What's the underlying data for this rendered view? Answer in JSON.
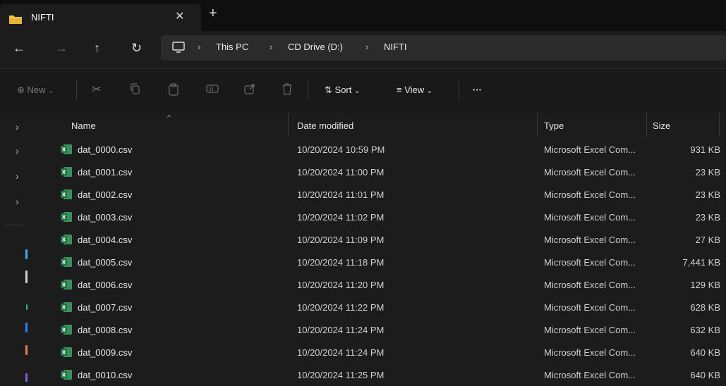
{
  "tab": {
    "title": "NIFTI",
    "close": "✕",
    "new": "+"
  },
  "nav": {
    "back": "←",
    "forward": "→",
    "up": "↑",
    "refresh": "↻"
  },
  "breadcrumb": [
    {
      "label": "This PC"
    },
    {
      "label": "CD Drive (D:)"
    },
    {
      "label": "NIFTI"
    }
  ],
  "toolbar": {
    "new_label": "New",
    "sort_label": "Sort",
    "view_label": "View",
    "more_label": "···"
  },
  "columns": {
    "name": "Name",
    "date": "Date modified",
    "type": "Type",
    "size": "Size"
  },
  "files": [
    {
      "name": "dat_0000.csv",
      "date": "10/20/2024 10:59 PM",
      "type": "Microsoft Excel Com...",
      "size": "931 KB"
    },
    {
      "name": "dat_0001.csv",
      "date": "10/20/2024 11:00 PM",
      "type": "Microsoft Excel Com...",
      "size": "23 KB"
    },
    {
      "name": "dat_0002.csv",
      "date": "10/20/2024 11:01 PM",
      "type": "Microsoft Excel Com...",
      "size": "23 KB"
    },
    {
      "name": "dat_0003.csv",
      "date": "10/20/2024 11:02 PM",
      "type": "Microsoft Excel Com...",
      "size": "23 KB"
    },
    {
      "name": "dat_0004.csv",
      "date": "10/20/2024 11:09 PM",
      "type": "Microsoft Excel Com...",
      "size": "27 KB"
    },
    {
      "name": "dat_0005.csv",
      "date": "10/20/2024 11:18 PM",
      "type": "Microsoft Excel Com...",
      "size": "7,441 KB"
    },
    {
      "name": "dat_0006.csv",
      "date": "10/20/2024 11:20 PM",
      "type": "Microsoft Excel Com...",
      "size": "129 KB"
    },
    {
      "name": "dat_0007.csv",
      "date": "10/20/2024 11:22 PM",
      "type": "Microsoft Excel Com...",
      "size": "628 KB"
    },
    {
      "name": "dat_0008.csv",
      "date": "10/20/2024 11:24 PM",
      "type": "Microsoft Excel Com...",
      "size": "632 KB"
    },
    {
      "name": "dat_0009.csv",
      "date": "10/20/2024 11:24 PM",
      "type": "Microsoft Excel Com...",
      "size": "640 KB"
    },
    {
      "name": "dat_0010.csv",
      "date": "10/20/2024 11:25 PM",
      "type": "Microsoft Excel Com...",
      "size": "640 KB"
    }
  ],
  "colors": {
    "excel_green": "#1e7145",
    "folder_yellow": "#f2c94c",
    "background": "#1c1c1c"
  }
}
